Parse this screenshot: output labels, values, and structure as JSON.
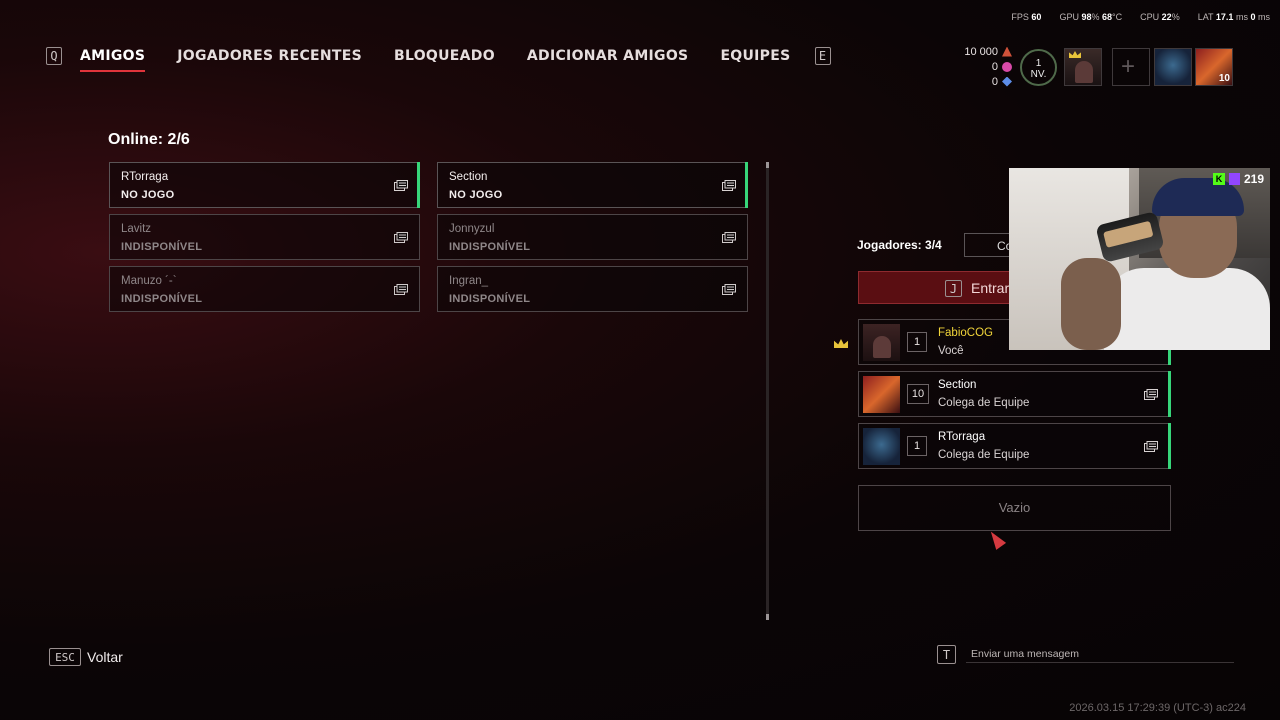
{
  "perf": {
    "fps_label": "FPS",
    "fps": "60",
    "gpu_label": "GPU",
    "gpu": "98",
    "gpu_unit": "%",
    "gpu_temp": "68",
    "gpu_temp_unit": "°C",
    "cpu_label": "CPU",
    "cpu": "22",
    "cpu_unit": "%",
    "lat_label": "LAT",
    "lat": "17.1",
    "lat_unit": "ms",
    "lat2": "0",
    "lat2_unit": "ms"
  },
  "nav": {
    "prev_key": "Q",
    "next_key": "E",
    "tabs": [
      "AMIGOS",
      "JOGADORES RECENTES",
      "BLOQUEADO",
      "ADICIONAR AMIGOS",
      "EQUIPES"
    ]
  },
  "friends": {
    "online_label": "Online: 2/6",
    "list": [
      {
        "name": "RTorraga",
        "status": "NO JOGO"
      },
      {
        "name": "Section",
        "status": "NO JOGO"
      },
      {
        "name": "Lavitz",
        "status": "INDISPONÍVEL"
      },
      {
        "name": "Jonnyzul",
        "status": "INDISPONÍVEL"
      },
      {
        "name": "Manuzo ´-`",
        "status": "INDISPONÍVEL"
      },
      {
        "name": "Ingran_",
        "status": "INDISPONÍVEL"
      }
    ]
  },
  "party": {
    "title": "Jogadores: 3/4",
    "c_button": "Co",
    "enter_key": "J",
    "enter_label": "Entrar",
    "members": [
      {
        "name": "FabioCOG",
        "level": "1",
        "role": "Você"
      },
      {
        "name": "Section",
        "level": "10",
        "role": "Colega de Equipe"
      },
      {
        "name": "RTorraga",
        "level": "1",
        "role": "Colega de Equipe"
      }
    ],
    "empty_label": "Vazio"
  },
  "header_right": {
    "currency1": "10 000",
    "currency2": "0",
    "currency3": "0",
    "level_num": "1",
    "level_label": "NV.",
    "slot_badge": "10"
  },
  "stream": {
    "viewers": "219",
    "kick": "K"
  },
  "footer": {
    "back_key": "ESC",
    "back_label": "Voltar",
    "msg_key": "T",
    "msg_placeholder": "Enviar uma mensagem",
    "timestamp": "2026.03.15 17:29:39 (UTC-3) ac224"
  },
  "colors": {
    "accent": "#e0343b",
    "online": "#37d67a",
    "host_name": "#f1d53a"
  }
}
